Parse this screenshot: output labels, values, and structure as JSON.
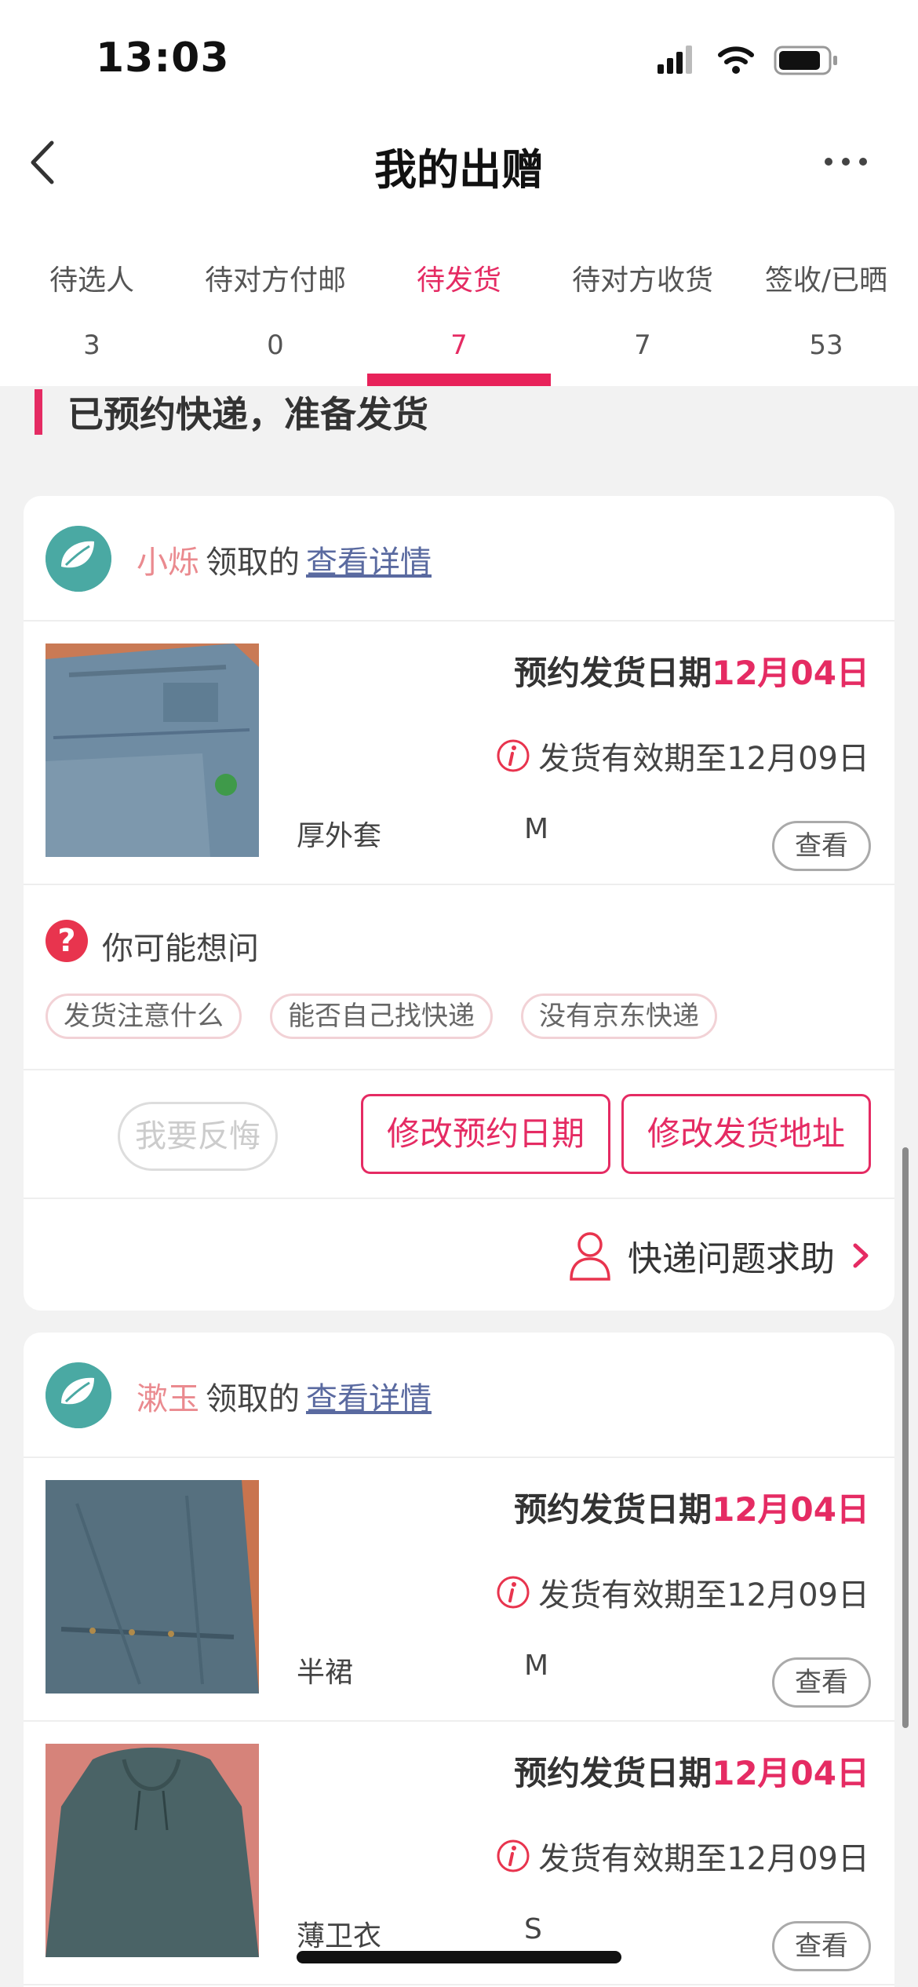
{
  "status": {
    "time": "13:03"
  },
  "nav": {
    "title": "我的出赠"
  },
  "tabs": [
    {
      "label": "待选人",
      "count": "3"
    },
    {
      "label": "待对方付邮",
      "count": "0"
    },
    {
      "label": "待发货",
      "count": "7"
    },
    {
      "label": "待对方收货",
      "count": "7"
    },
    {
      "label": "签收/已晒",
      "count": "53"
    }
  ],
  "active_tab": "待发货",
  "section": {
    "title": "已预约快递，准备发货"
  },
  "orders": [
    {
      "user": "小烁",
      "claimed_text": "领取的",
      "detail_link": "查看详情",
      "items": [
        {
          "date_label": "预约发货日期",
          "date": "12月04日",
          "valid_text": "发货有效期至12月09日",
          "name": "厚外套",
          "size": "M",
          "view": "查看"
        }
      ],
      "faq": {
        "title": "你可能想问",
        "chips": [
          "发货注意什么",
          "能否自己找快递",
          "没有京东快递"
        ]
      },
      "actions": {
        "regret": "我要反悔",
        "change_date": "修改预约日期",
        "change_address": "修改发货地址"
      },
      "help": "快递问题求助"
    },
    {
      "user": "漱玉",
      "claimed_text": "领取的",
      "detail_link": "查看详情",
      "items": [
        {
          "date_label": "预约发货日期",
          "date": "12月04日",
          "valid_text": "发货有效期至12月09日",
          "name": "半裙",
          "size": "M",
          "view": "查看"
        },
        {
          "date_label": "预约发货日期",
          "date": "12月04日",
          "valid_text": "发货有效期至12月09日",
          "name": "薄卫衣",
          "size": "S",
          "view": "查看"
        }
      ]
    }
  ],
  "colors": {
    "accent": "#e52b63",
    "username": "#ea8a8f",
    "link": "#5a6aa0",
    "avatar": "#4aa9a3"
  },
  "icons": [
    "back-icon",
    "more-icon",
    "info-icon",
    "question-icon",
    "person-icon",
    "chevron-right-icon",
    "signal-icon",
    "wifi-icon",
    "battery-icon"
  ]
}
